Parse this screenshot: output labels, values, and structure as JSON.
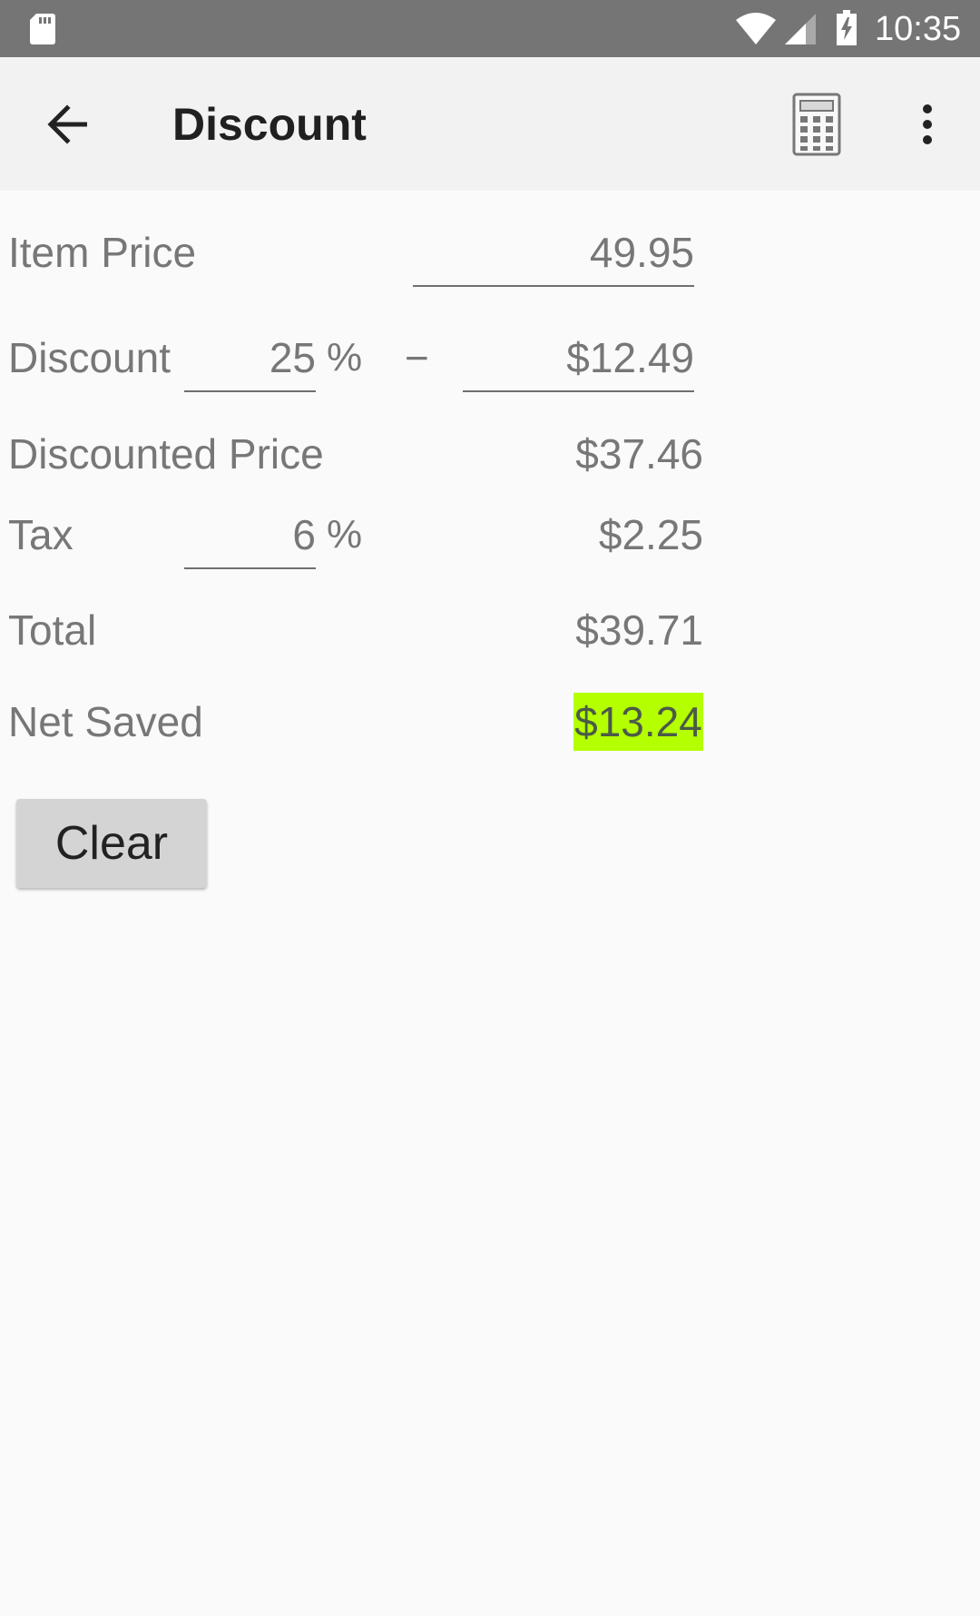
{
  "status_bar": {
    "time": "10:35",
    "icons": [
      "sd-card-icon",
      "wifi-icon",
      "signal-icon",
      "battery-charging-icon"
    ]
  },
  "toolbar": {
    "title": "Discount",
    "back_icon": "back-arrow-icon",
    "calculator_icon": "calculator-icon",
    "overflow_icon": "more-vert-icon"
  },
  "form": {
    "item_price": {
      "label": "Item Price",
      "value": "49.95"
    },
    "discount": {
      "label": "Discount",
      "percent": "25",
      "percent_symbol": "%",
      "minus": "−",
      "amount": "$12.49"
    },
    "discounted_price": {
      "label": "Discounted Price",
      "value": "$37.46"
    },
    "tax": {
      "label": "Tax",
      "percent": "6",
      "percent_symbol": "%",
      "amount": "$2.25"
    },
    "total": {
      "label": "Total",
      "value": "$39.71"
    },
    "net_saved": {
      "label": "Net Saved",
      "value": "$13.24",
      "highlight_color": "#b4ff00"
    }
  },
  "actions": {
    "clear_label": "Clear"
  },
  "colors": {
    "status_bar": "#757575",
    "toolbar": "#f2f2f2",
    "background": "#fafafa",
    "text_secondary": "#777777"
  }
}
